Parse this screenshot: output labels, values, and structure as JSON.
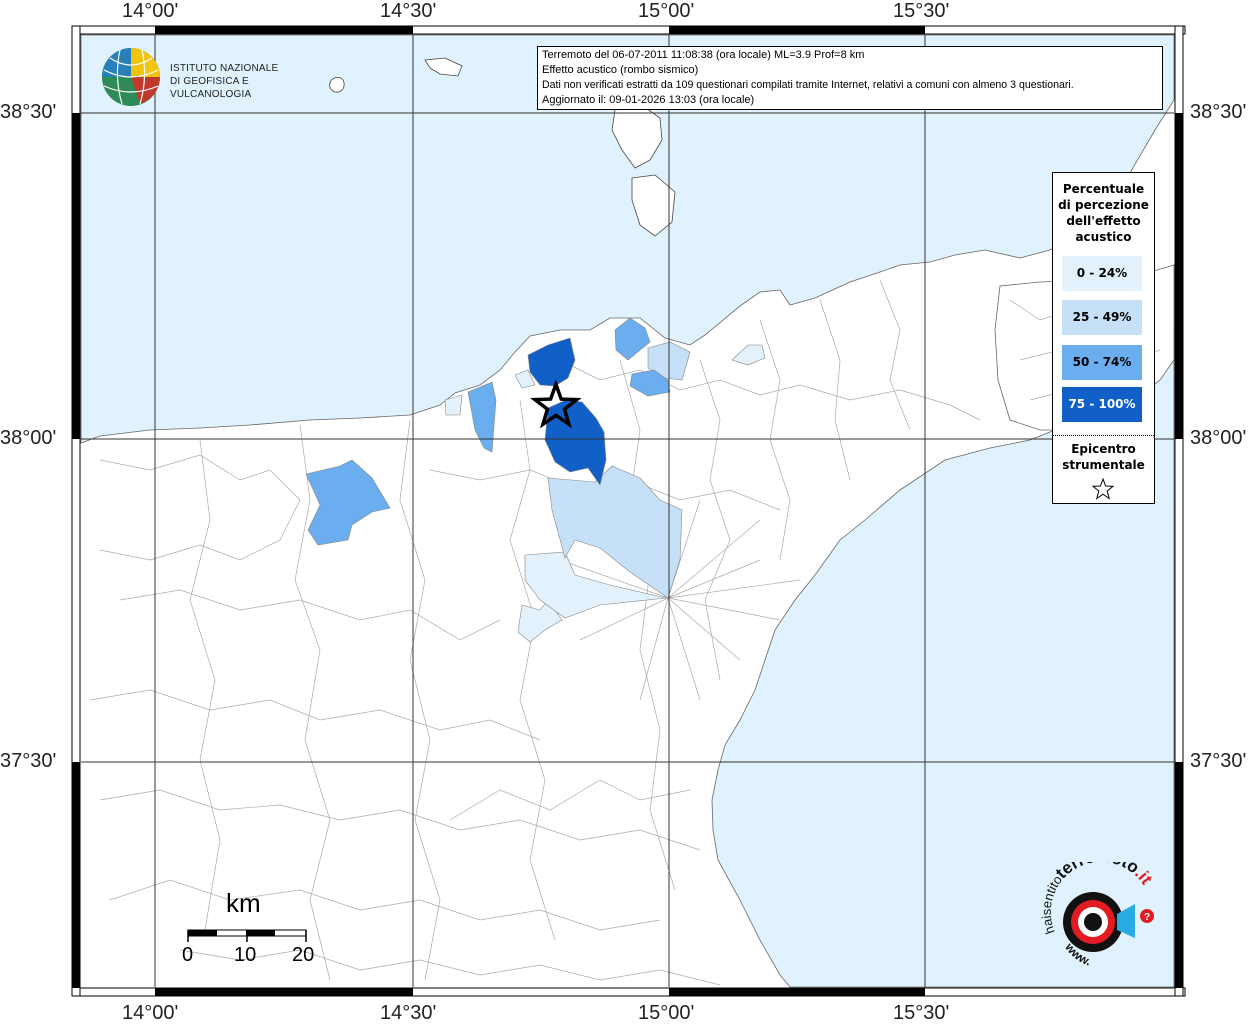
{
  "map": {
    "lon_labels": [
      "14°00'",
      "14°30'",
      "15°00'",
      "15°30'"
    ],
    "lat_labels": [
      "38°30'",
      "38°00'",
      "37°30'"
    ],
    "sea_color": "#e0f2fd",
    "land_color": "#ffffff",
    "epicenter": {
      "lon": 14.78,
      "lat": 38.05
    }
  },
  "info": {
    "line1": "Terremoto del 06-07-2011 11:08:38 (ora locale) ML=3.9 Prof=8 km",
    "line2": "Effetto acustico (rombo sismico)",
    "line3": "Dati non verificati estratti da 109 questionari compilati tramite Internet, relativi a comuni con almeno 3 questionari.",
    "line4": "Aggiornato il: 09-01-2026 13:03 (ora locale)"
  },
  "ingv_logo": {
    "line1": "ISTITUTO NAZIONALE",
    "line2": "DI GEOFISICA E VULCANOLOGIA"
  },
  "legend": {
    "title_lines": [
      "Percentuale",
      "di percezione",
      "dell'effetto",
      "acustico"
    ],
    "items": [
      {
        "label": "0 - 24%",
        "color": "#e2f1fc",
        "text_color": "#000000"
      },
      {
        "label": "25 - 49%",
        "color": "#c6e0f8",
        "text_color": "#000000"
      },
      {
        "label": "50 - 74%",
        "color": "#6aaef0",
        "text_color": "#000000"
      },
      {
        "label": "75 - 100%",
        "color": "#1060c8",
        "text_color": "#ffffff"
      }
    ],
    "epicenter_lines": [
      "Epicentro",
      "strumentale"
    ]
  },
  "scalebar": {
    "title": "km",
    "labels": [
      "0",
      "10",
      "20"
    ]
  },
  "brand_logo": {
    "text_top": "terremoto",
    "text_suffix": ".it",
    "text_prefix": "haisentito",
    "text_bottom": "www.",
    "badge": "?"
  }
}
